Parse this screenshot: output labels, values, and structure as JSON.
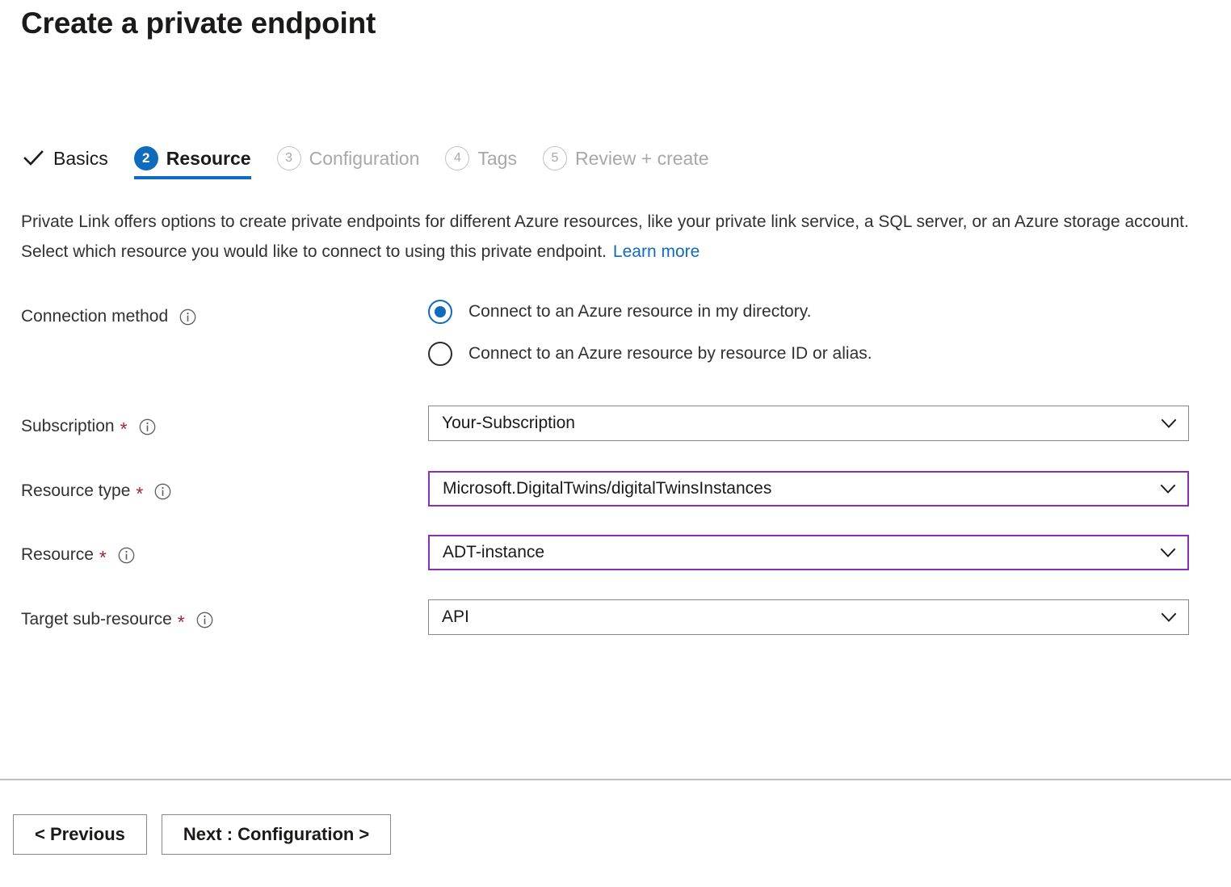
{
  "page": {
    "title": "Create a private endpoint"
  },
  "wizard": {
    "tabs": [
      {
        "marker": "check",
        "marker_text": "",
        "label": "Basics",
        "state": "done"
      },
      {
        "marker": "number",
        "marker_text": "2",
        "label": "Resource",
        "state": "active"
      },
      {
        "marker": "number",
        "marker_text": "3",
        "label": "Configuration",
        "state": "todo"
      },
      {
        "marker": "number",
        "marker_text": "4",
        "label": "Tags",
        "state": "todo"
      },
      {
        "marker": "number",
        "marker_text": "5",
        "label": "Review + create",
        "state": "todo"
      }
    ],
    "active_accent": "#0f6cbd"
  },
  "description": {
    "text": "Private Link offers options to create private endpoints for different Azure resources, like your private link service, a SQL server, or an Azure storage account. Select which resource you would like to connect to using this private endpoint.",
    "link_label": "Learn more"
  },
  "form": {
    "connection_method": {
      "label": "Connection method",
      "info_icon": "info-icon",
      "options": [
        {
          "label": "Connect to an Azure resource in my directory.",
          "selected": true
        },
        {
          "label": "Connect to an Azure resource by resource ID or alias.",
          "selected": false
        }
      ]
    },
    "fields": [
      {
        "label": "Subscription",
        "required_mark": "*",
        "info_icon": "info-icon",
        "value": "Your-Subscription",
        "chevron_icon": "chevron-down-icon",
        "highlighted": false
      },
      {
        "label": "Resource type",
        "required_mark": "*",
        "info_icon": "info-icon",
        "value": "Microsoft.DigitalTwins/digitalTwinsInstances",
        "chevron_icon": "chevron-down-icon",
        "highlighted": true
      },
      {
        "label": "Resource",
        "required_mark": "*",
        "info_icon": "info-icon",
        "value": "ADT-instance",
        "chevron_icon": "chevron-down-icon",
        "highlighted": true
      },
      {
        "label": "Target sub-resource",
        "required_mark": "*",
        "info_icon": "info-icon",
        "value": "API",
        "chevron_icon": "chevron-down-icon",
        "highlighted": false
      }
    ],
    "highlight_color": "#8b2fb4",
    "required_color": "#a4262c"
  },
  "footer": {
    "previous_label": "< Previous",
    "next_label": "Next : Configuration >"
  }
}
